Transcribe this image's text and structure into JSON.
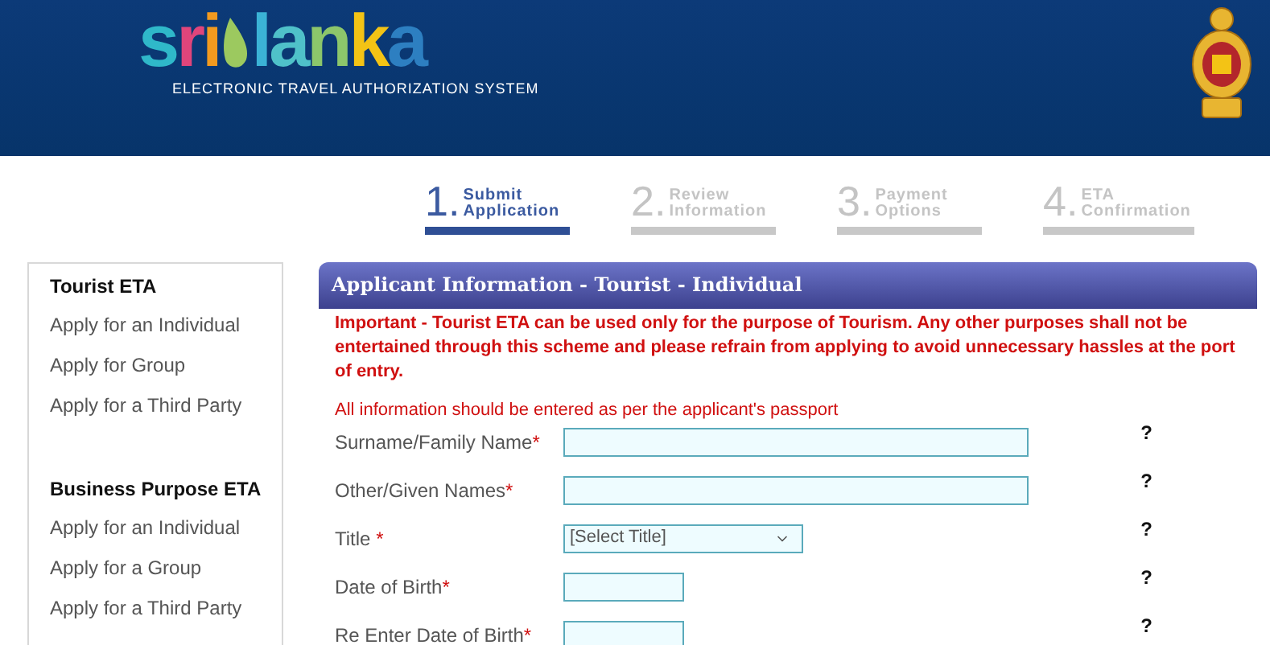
{
  "header": {
    "logo_first": "sri",
    "logo_second": "lanka",
    "subtitle": "ELECTRONIC TRAVEL AUTHORIZATION SYSTEM"
  },
  "steps": [
    {
      "number": "1.",
      "label_1": "Submit",
      "label_2": "Application",
      "selected": true
    },
    {
      "number": "2.",
      "label_1": "Review",
      "label_2": "Information",
      "selected": false
    },
    {
      "number": "3.",
      "label_1": "Payment",
      "label_2": "Options",
      "selected": false
    },
    {
      "number": "4.",
      "label_1": "ETA",
      "label_2": "Confirmation",
      "selected": false
    }
  ],
  "sidebar": [
    {
      "heading": "Tourist ETA",
      "items": [
        "Apply for an Individual",
        "Apply for Group",
        "Apply for a Third Party"
      ]
    },
    {
      "heading": "Business Purpose ETA",
      "items": [
        "Apply for an Individual",
        "Apply for a Group",
        "Apply for a Third Party"
      ]
    }
  ],
  "panel": {
    "title": "Applicant Information - Tourist - Individual",
    "important": "Important - Tourist ETA can be used only for the purpose of Tourism. Any other purposes shall not be entertained through this scheme and please refrain from applying to avoid unnecessary hassles at the port of entry.",
    "note": "All information should be entered as per the applicant's passport",
    "fields": [
      {
        "kind": "long",
        "label": "Surname/Family Name",
        "required": "*",
        "help": "?"
      },
      {
        "kind": "long",
        "label": "Other/Given Names",
        "required": "*",
        "help": "?"
      },
      {
        "kind": "select",
        "label": "Title",
        "required": "*",
        "value": "[Select Title]",
        "help": "?"
      },
      {
        "kind": "short",
        "label": "Date of Birth",
        "required": "*",
        "help": "?"
      },
      {
        "kind": "short",
        "label": "Re Enter Date of Birth",
        "required": "*",
        "help": "?"
      }
    ]
  }
}
